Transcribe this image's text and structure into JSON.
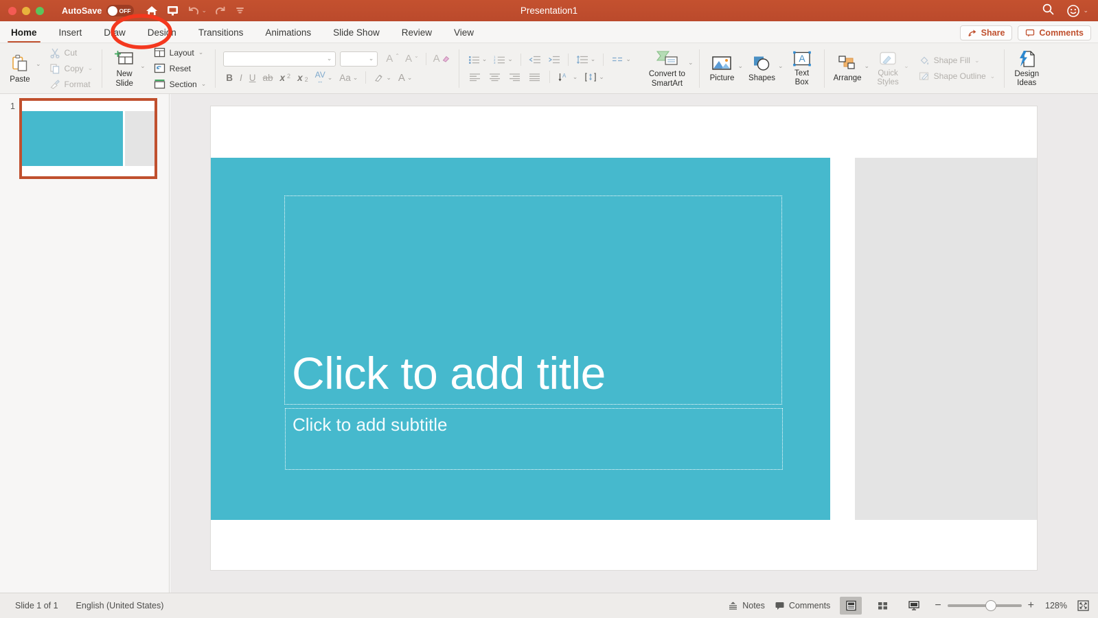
{
  "titlebar": {
    "autosave_label": "AutoSave",
    "autosave_state": "OFF",
    "document_title": "Presentation1",
    "quick_access": [
      {
        "name": "home-icon",
        "label": "Home"
      },
      {
        "name": "present-icon",
        "label": "Present"
      },
      {
        "name": "undo-icon",
        "label": "Undo"
      },
      {
        "name": "redo-icon",
        "label": "Redo"
      },
      {
        "name": "customize-toolbar-icon",
        "label": "Customize Quick Access Toolbar"
      }
    ],
    "search_label": "Search",
    "account_label": "Account",
    "accent_color": "#c0502e"
  },
  "tabs": [
    {
      "label": "Home",
      "active": true
    },
    {
      "label": "Insert",
      "active": false
    },
    {
      "label": "Draw",
      "active": false
    },
    {
      "label": "Design",
      "active": false
    },
    {
      "label": "Transitions",
      "active": false
    },
    {
      "label": "Animations",
      "active": false
    },
    {
      "label": "Slide Show",
      "active": false
    },
    {
      "label": "Review",
      "active": false
    },
    {
      "label": "View",
      "active": false
    }
  ],
  "tab_actions": {
    "share_label": "Share",
    "comments_label": "Comments"
  },
  "ribbon": {
    "clipboard": {
      "paste_label": "Paste",
      "cut_label": "Cut",
      "copy_label": "Copy",
      "format_label": "Format"
    },
    "slides": {
      "new_slide_label": "New\nSlide",
      "new_slide_line1": "New",
      "new_slide_line2": "Slide",
      "layout_label": "Layout",
      "reset_label": "Reset",
      "section_label": "Section"
    },
    "font": {
      "font_name_value": "",
      "font_name_placeholder": "",
      "font_size_value": "",
      "font_size_placeholder": "",
      "grow_font_label": "A",
      "shrink_font_label": "A",
      "clear_formatting_label": "A",
      "bold_label": "B",
      "italic_label": "I",
      "underline_label": "U",
      "strikethrough_label": "ab",
      "superscript_label": "x",
      "subscript_label": "x",
      "character_spacing_label": "AV",
      "change_case_label": "Aa",
      "text_highlight_label": "Highlight",
      "font_color_label": "A"
    },
    "paragraph": {
      "bullets_label": "Bullets",
      "numbering_label": "Numbering",
      "decrease_indent_label": "Decrease Indent",
      "increase_indent_label": "Increase Indent",
      "line_spacing_label": "Line Spacing",
      "columns_label": "Columns",
      "align_left_label": "Align Left",
      "align_center_label": "Center",
      "align_right_label": "Align Right",
      "justify_label": "Justify",
      "text_direction_label": "Text Direction",
      "align_text_label": "Align Text",
      "convert_smartart_line1": "Convert to",
      "convert_smartart_line2": "SmartArt"
    },
    "insert": {
      "picture_label": "Picture",
      "shapes_label": "Shapes",
      "textbox_line1": "Text",
      "textbox_line2": "Box"
    },
    "drawing": {
      "arrange_label": "Arrange",
      "quick_styles_line1": "Quick",
      "quick_styles_line2": "Styles",
      "shape_fill_label": "Shape Fill",
      "shape_outline_label": "Shape Outline"
    },
    "designer": {
      "design_ideas_line1": "Design",
      "design_ideas_line2": "Ideas"
    }
  },
  "slide_panel": {
    "slide_number": "1"
  },
  "slide": {
    "title_placeholder": "Click to add title",
    "subtitle_placeholder": "Click to add subtitle",
    "theme_color": "#46b9cd",
    "accent_gray": "#e4e4e4"
  },
  "status_bar": {
    "slide_count_label": "Slide 1 of 1",
    "language_label": "English (United States)",
    "notes_label": "Notes",
    "comments_label": "Comments",
    "normal_view_label": "Normal View",
    "slide_sorter_label": "Slide Sorter",
    "slideshow_label": "Slide Show",
    "zoom_out_label": "−",
    "zoom_in_label": "+",
    "zoom_value": "128%",
    "fit_label": "Fit slide to window"
  },
  "annotation": {
    "type": "ellipse-highlight",
    "target_label": "Design",
    "color": "#f4381e"
  }
}
